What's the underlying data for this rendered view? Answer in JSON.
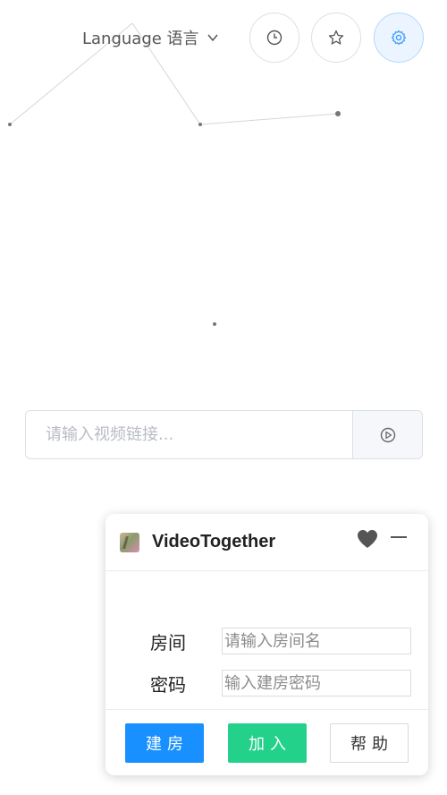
{
  "header": {
    "language_label": "Language 语言",
    "language_icon": "chevron-down-icon",
    "history_icon": "clock-icon",
    "favorites_icon": "star-icon",
    "settings_icon": "gear-icon"
  },
  "url_bar": {
    "placeholder": "请输入视频链接...",
    "value": "",
    "play_icon": "play-circle-icon"
  },
  "videotogether": {
    "title": "VideoTogether",
    "heart_icon": "heart-icon",
    "minimize_icon": "minimize-icon",
    "room_label": "房间",
    "room_placeholder": "请输入房间名",
    "password_label": "密码",
    "password_placeholder": "输入建房密码",
    "create_label": "建房",
    "join_label": "加入",
    "help_label": "帮助"
  },
  "colors": {
    "accent_blue": "#1890ff",
    "accent_green": "#23d18b",
    "settings_bg": "#ecf5ff"
  }
}
